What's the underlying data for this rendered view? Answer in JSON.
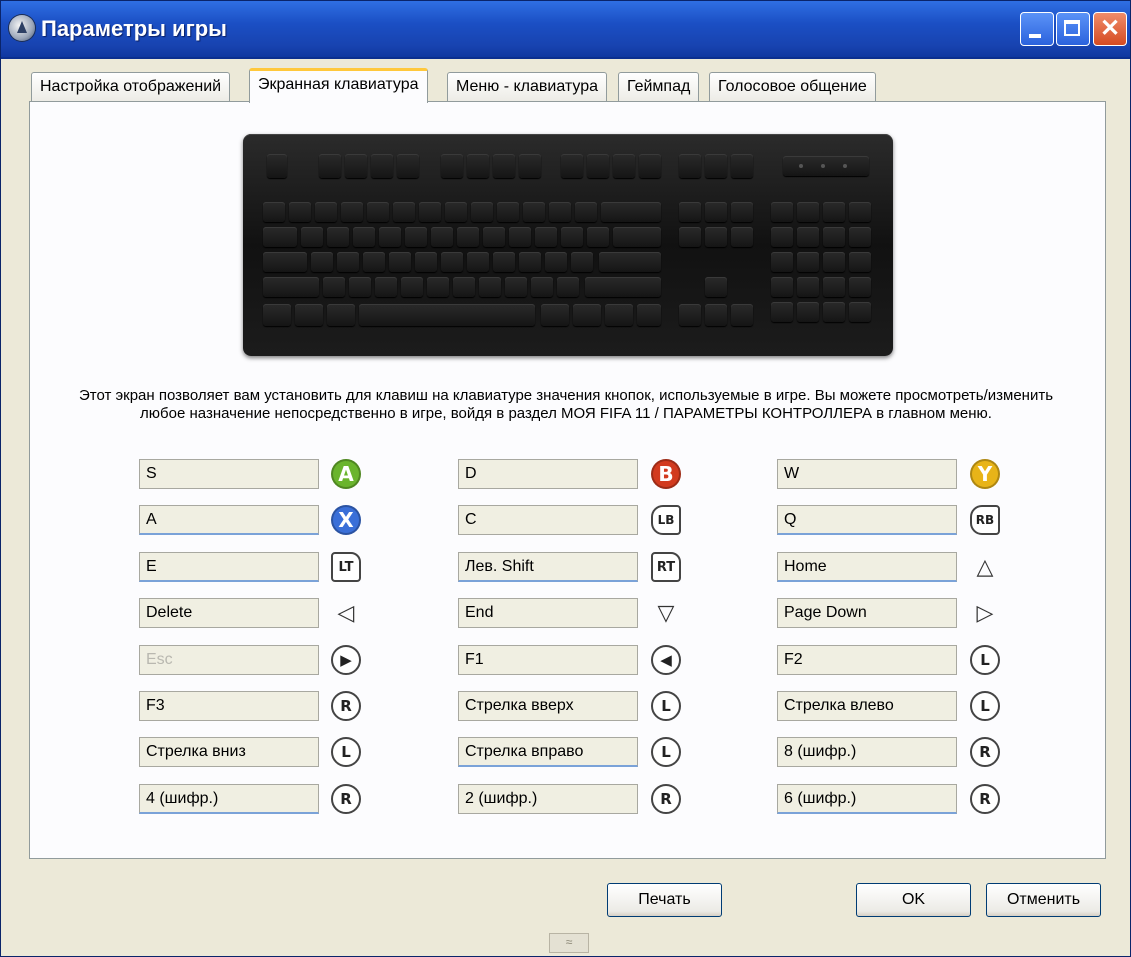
{
  "window": {
    "title": "Параметры игры"
  },
  "tabs": [
    {
      "label": "Настройка отображений"
    },
    {
      "label": "Экранная клавиатура"
    },
    {
      "label": "Меню - клавиатура"
    },
    {
      "label": "Геймпад"
    },
    {
      "label": "Голосовое общение"
    }
  ],
  "active_tab": "Экранная клавиатура",
  "description": "Этот экран позволяет вам установить для клавиш на клавиатуре значения кнопок, используемые в игре. Вы можете просмотреть/изменить любое назначение непосредственно в игре, войдя в раздел МОЯ FIFA 11 / ПАРАМЕТРЫ КОНТРОЛЛЕРА в главном меню.",
  "bindings": [
    [
      {
        "key": "S",
        "icon": "a-button-icon",
        "glyph": "A"
      },
      {
        "key": "A",
        "icon": "x-button-icon",
        "glyph": "X"
      },
      {
        "key": "E",
        "icon": "left-trigger-icon",
        "glyph": "LT"
      },
      {
        "key": "Delete",
        "icon": "dpad-left-icon",
        "glyph": "◁"
      },
      {
        "key": "Esc",
        "icon": "start-button-icon",
        "glyph": "▶",
        "disabled": true
      },
      {
        "key": "F3",
        "icon": "right-stick-click-icon",
        "glyph": "R"
      },
      {
        "key": "Стрелка вниз",
        "icon": "left-stick-down-icon",
        "glyph": "L"
      },
      {
        "key": "4 (шифр.)",
        "icon": "right-stick-left-icon",
        "glyph": "R"
      }
    ],
    [
      {
        "key": "D",
        "icon": "b-button-icon",
        "glyph": "B"
      },
      {
        "key": "C",
        "icon": "left-bumper-icon",
        "glyph": "LB"
      },
      {
        "key": "Лев. Shift",
        "icon": "right-trigger-icon",
        "glyph": "RT"
      },
      {
        "key": "End",
        "icon": "dpad-down-icon",
        "glyph": "▽"
      },
      {
        "key": "F1",
        "icon": "back-button-icon",
        "glyph": "◀"
      },
      {
        "key": "Стрелка вверх",
        "icon": "left-stick-up-icon",
        "glyph": "L"
      },
      {
        "key": "Стрелка вправо",
        "icon": "left-stick-right-icon",
        "glyph": "L"
      },
      {
        "key": "2 (шифр.)",
        "icon": "right-stick-down-icon",
        "glyph": "R"
      }
    ],
    [
      {
        "key": "W",
        "icon": "y-button-icon",
        "glyph": "Y"
      },
      {
        "key": "Q",
        "icon": "right-bumper-icon",
        "glyph": "RB"
      },
      {
        "key": "Home",
        "icon": "dpad-up-icon",
        "glyph": "△"
      },
      {
        "key": "Page Down",
        "icon": "dpad-right-icon",
        "glyph": "▷"
      },
      {
        "key": "F2",
        "icon": "left-stick-click-icon",
        "glyph": "L"
      },
      {
        "key": "Стрелка влево",
        "icon": "left-stick-left-icon",
        "glyph": "L"
      },
      {
        "key": "8 (шифр.)",
        "icon": "right-stick-up-icon",
        "glyph": "R"
      },
      {
        "key": "6 (шифр.)",
        "icon": "right-stick-right-icon",
        "glyph": "R"
      }
    ]
  ],
  "colors": {
    "a_button": "#6ab42d",
    "b_button": "#d23a1e",
    "x_button": "#3a6fd8",
    "y_button": "#e8b418"
  },
  "buttons": {
    "print": "Печать",
    "ok": "OK",
    "cancel": "Отменить"
  }
}
